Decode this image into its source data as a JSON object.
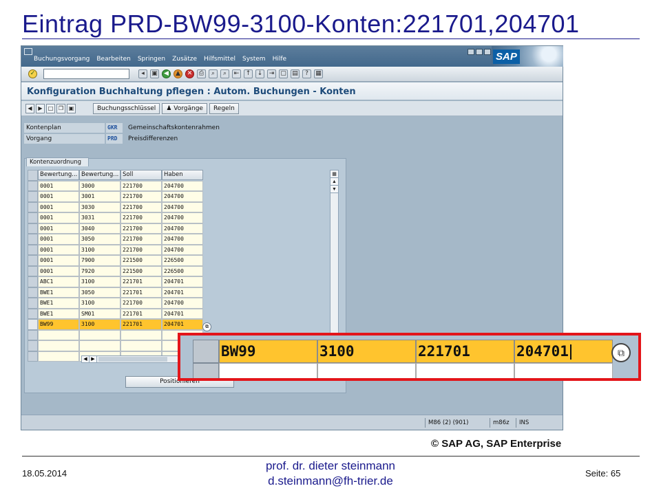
{
  "slide": {
    "title": "Eintrag PRD-BW99-3100-Konten:221701,204701",
    "copyright": "© SAP AG, SAP Enterprise",
    "footer": {
      "date": "18.05.2014",
      "author_name": "prof. dr. dieter steinmann",
      "author_email": "d.steinmann@fh-trier.de",
      "page": "Seite: 65"
    }
  },
  "sap": {
    "logo_text": "SAP",
    "menu": [
      "Buchungsvorgang",
      "Bearbeiten",
      "Springen",
      "Zusätze",
      "Hilfsmittel",
      "System",
      "Hilfe"
    ],
    "screen_title": "Konfiguration Buchhaltung pflegen : Autom. Buchungen - Konten",
    "app_buttons": [
      "Buchungsschlüssel",
      "Vorgänge",
      "Regeln"
    ],
    "fields": {
      "kontenplan": {
        "label": "Kontenplan",
        "value": "GKR",
        "desc": "Gemeinschaftskontenrahmen"
      },
      "vorgang": {
        "label": "Vorgang",
        "value": "PRD",
        "desc": "Preisdifferenzen"
      }
    },
    "tab_label": "Kontenzuordnung",
    "table": {
      "headers": [
        "Bewertung...",
        "Bewertung...",
        "Soll",
        "Haben"
      ],
      "rows": [
        [
          "0001",
          "3000",
          "221700",
          "204700"
        ],
        [
          "0001",
          "3001",
          "221700",
          "204700"
        ],
        [
          "0001",
          "3030",
          "221700",
          "204700"
        ],
        [
          "0001",
          "3031",
          "221700",
          "204700"
        ],
        [
          "0001",
          "3040",
          "221700",
          "204700"
        ],
        [
          "0001",
          "3050",
          "221700",
          "204700"
        ],
        [
          "0001",
          "3100",
          "221700",
          "204700"
        ],
        [
          "0001",
          "7900",
          "221500",
          "226500"
        ],
        [
          "0001",
          "7920",
          "221500",
          "226500"
        ],
        [
          "ABC1",
          "3100",
          "221701",
          "204701"
        ],
        [
          "BWE1",
          "3050",
          "221701",
          "204701"
        ],
        [
          "BWE1",
          "3100",
          "221700",
          "204700"
        ],
        [
          "BWE1",
          "SM01",
          "221701",
          "204701"
        ],
        [
          "BW99",
          "3100",
          "221701",
          "204701"
        ]
      ]
    },
    "position_button": "Positionieren",
    "status": {
      "system": "M86 (2) (901)",
      "server": "m86z",
      "mode": "INS"
    }
  },
  "zoom": {
    "values": [
      "BW99",
      "3100",
      "221701",
      "204701"
    ]
  }
}
